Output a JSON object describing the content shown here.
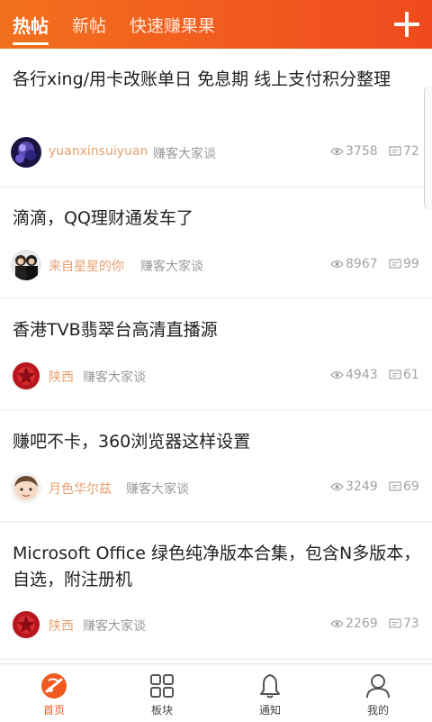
{
  "tabs": [
    {
      "label": "热帖"
    },
    {
      "label": "新帖"
    },
    {
      "label": "快速赚果果"
    }
  ],
  "posts": [
    {
      "title": "各行xing/用卡改账单日 免息期 线上支付积分整理",
      "author": "yuanxinsuiyuan",
      "board": "赚客大家谈",
      "views": "3758",
      "replies": "72"
    },
    {
      "title": "滴滴，QQ理财通发车了",
      "author": "来自星星的你",
      "board": "赚客大家谈",
      "views": "8967",
      "replies": "99"
    },
    {
      "title": "香港TVB翡翠台高清直播源",
      "author": "陕西",
      "board": "赚客大家谈",
      "views": "4943",
      "replies": "61"
    },
    {
      "title": "赚吧不卡，360浏览器这样设置",
      "author": "月色华尔兹",
      "board": "赚客大家谈",
      "views": "3249",
      "replies": "69"
    },
    {
      "title": "Microsoft Office 绿色纯净版本合集，包含N多版本，自选，附注册机",
      "author": "陕西",
      "board": "赚客大家谈",
      "views": "2269",
      "replies": "73"
    }
  ],
  "nav": [
    {
      "label": "首页",
      "icon": "home-icon"
    },
    {
      "label": "板块",
      "icon": "grid-icon"
    },
    {
      "label": "通知",
      "icon": "bell-icon"
    },
    {
      "label": "我的",
      "icon": "user-icon"
    }
  ],
  "colors": {
    "accent": "#f25a1f",
    "author": "#e8a070"
  }
}
